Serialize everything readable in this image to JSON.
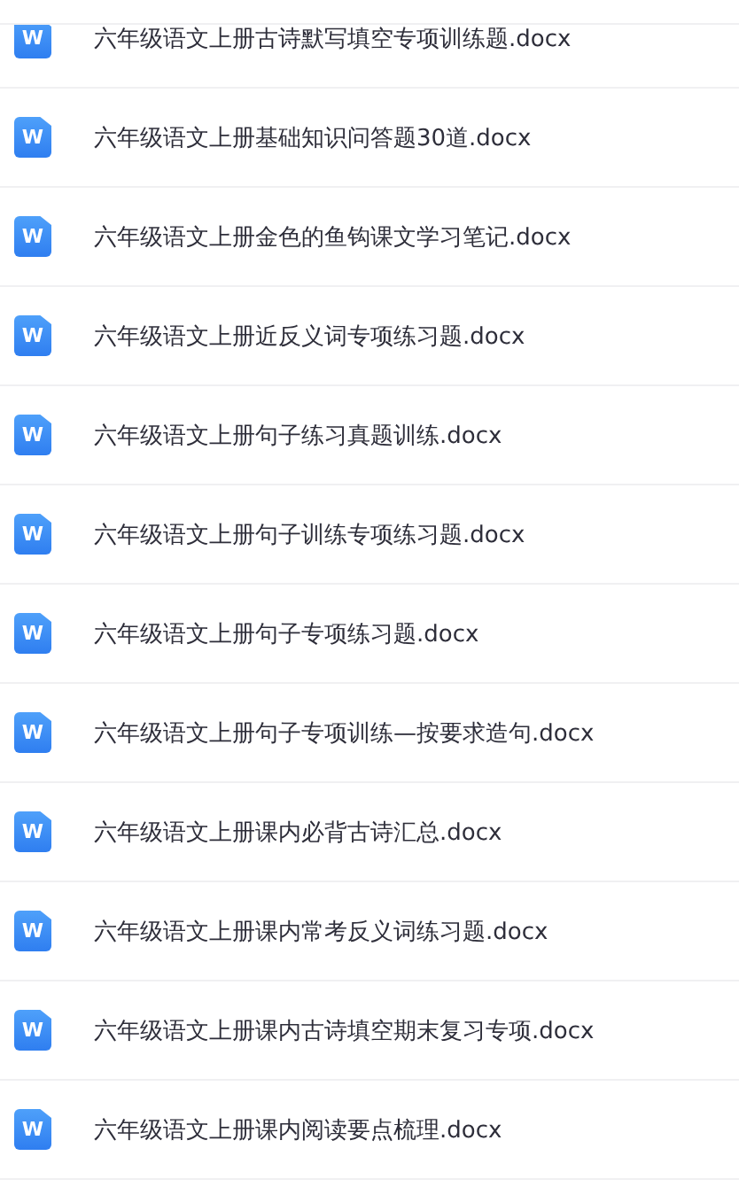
{
  "files": [
    {
      "name": "六年级语文上册古诗默写填空专项训练题.docx",
      "icon_label": "W"
    },
    {
      "name": "六年级语文上册基础知识问答题30道.docx",
      "icon_label": "W"
    },
    {
      "name": "六年级语文上册金色的鱼钩课文学习笔记.docx",
      "icon_label": "W"
    },
    {
      "name": "六年级语文上册近反义词专项练习题.docx",
      "icon_label": "W"
    },
    {
      "name": "六年级语文上册句子练习真题训练.docx",
      "icon_label": "W"
    },
    {
      "name": "六年级语文上册句子训练专项练习题.docx",
      "icon_label": "W"
    },
    {
      "name": "六年级语文上册句子专项练习题.docx",
      "icon_label": "W"
    },
    {
      "name": "六年级语文上册句子专项训练—按要求造句.docx",
      "icon_label": "W"
    },
    {
      "name": "六年级语文上册课内必背古诗汇总.docx",
      "icon_label": "W"
    },
    {
      "name": "六年级语文上册课内常考反义词练习题.docx",
      "icon_label": "W"
    },
    {
      "name": "六年级语文上册课内古诗填空期末复习专项.docx",
      "icon_label": "W"
    },
    {
      "name": "六年级语文上册课内阅读要点梳理.docx",
      "icon_label": "W"
    }
  ]
}
